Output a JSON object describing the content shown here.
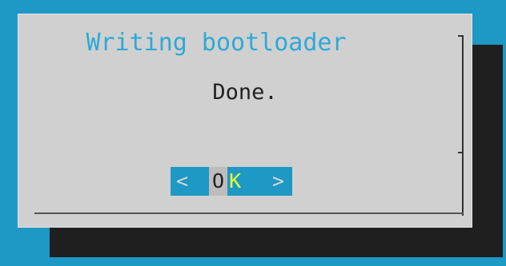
{
  "dialog": {
    "title": "Writing bootloader",
    "message": "Done.",
    "ok_button": {
      "left_bracket": "<",
      "label_prefix": "O",
      "label_hotkey": "K",
      "right_bracket": ">"
    }
  },
  "colors": {
    "background": "#1e98c4",
    "dialog": "#d0d0d0",
    "title": "#2fa9d6",
    "hotkey": "#e7ff3a",
    "shadow": "#1f1f1f"
  }
}
